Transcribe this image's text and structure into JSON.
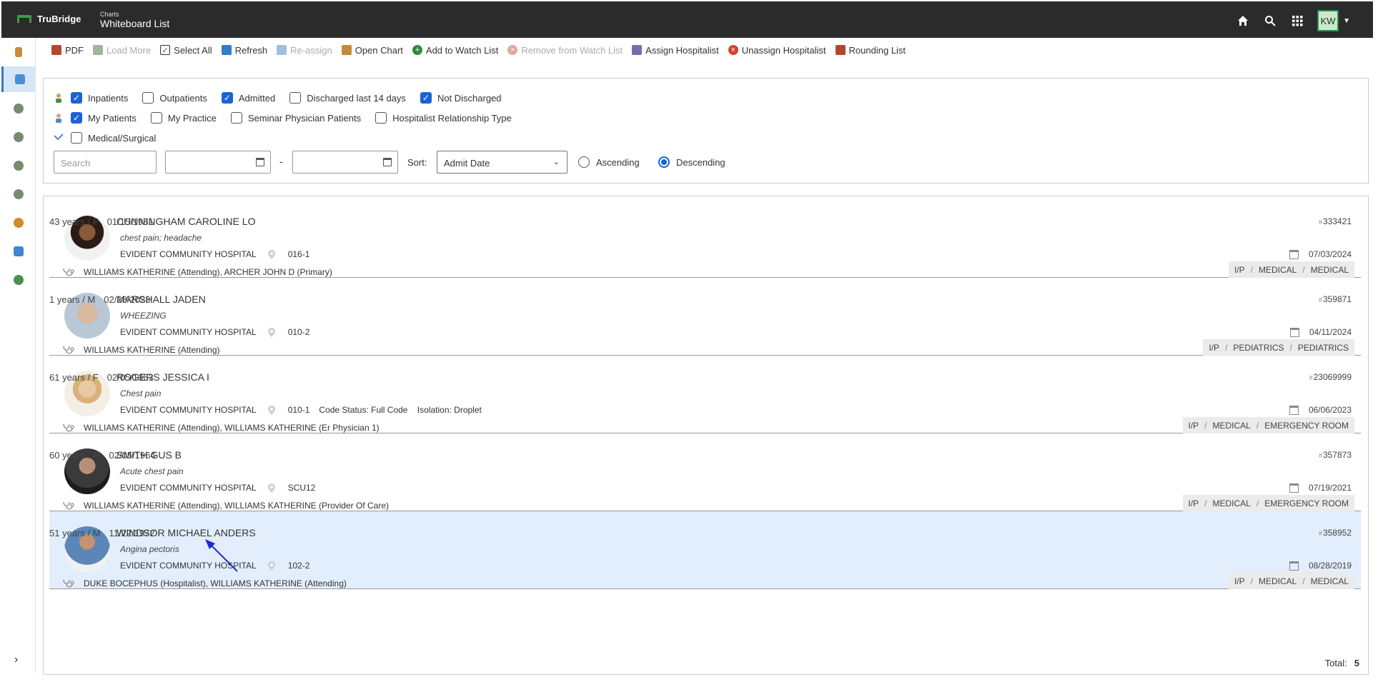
{
  "header": {
    "brand": "TruBridge",
    "breadcrumb_small": "Charts",
    "title": "Whiteboard List",
    "icons": [
      "home-icon",
      "search-icon",
      "apps-grid-icon"
    ],
    "user_initials": "KW",
    "colors": {
      "bar": "#2b2b2b",
      "accent": "#3a9b4a"
    }
  },
  "toolbar": {
    "items": [
      {
        "label": "PDF",
        "icon": "pdf-icon",
        "enabled": true
      },
      {
        "label": "Load More",
        "icon": "load-more-icon",
        "enabled": false
      },
      {
        "label": "Select All",
        "icon": "select-all-checkbox-icon",
        "enabled": true
      },
      {
        "label": "Refresh",
        "icon": "refresh-icon",
        "enabled": true
      },
      {
        "label": "Re-assign",
        "icon": "reassign-icon",
        "enabled": false
      },
      {
        "label": "Open Chart",
        "icon": "chart-icon",
        "enabled": true
      },
      {
        "label": "Add to Watch List",
        "icon": "plus-circle-icon",
        "enabled": true
      },
      {
        "label": "Remove from Watch List",
        "icon": "remove-circle-icon",
        "enabled": false
      },
      {
        "label": "Assign Hospitalist",
        "icon": "assign-icon",
        "enabled": true
      },
      {
        "label": "Unassign Hospitalist",
        "icon": "unassign-icon",
        "enabled": true
      },
      {
        "label": "Rounding List",
        "icon": "rounding-list-icon",
        "enabled": true
      }
    ]
  },
  "filters": {
    "row1": [
      {
        "label": "Inpatients",
        "checked": true
      },
      {
        "label": "Outpatients",
        "checked": false
      },
      {
        "label": "Admitted",
        "checked": true
      },
      {
        "label": "Discharged last 14 days",
        "checked": false
      },
      {
        "label": "Not Discharged",
        "checked": true
      }
    ],
    "row2": [
      {
        "label": "My Patients",
        "checked": true
      },
      {
        "label": "My Practice",
        "checked": false
      },
      {
        "label": "Seminar Physician Patients",
        "checked": false
      },
      {
        "label": "Hospitalist Relationship Type",
        "checked": false
      }
    ],
    "row3": [
      {
        "label": "Medical/Surgical",
        "checked": false
      }
    ],
    "search_placeholder": "Search",
    "date_from": "",
    "date_to": "",
    "date_separator": "-",
    "sort_label": "Sort:",
    "sort_value": "Admit Date",
    "ascending_label": "Ascending",
    "descending_label": "Descending",
    "sort_direction": "Descending"
  },
  "patients": [
    {
      "name": "CUNNINGHAM CAROLINE LO",
      "age_sex": "43 years / F",
      "dob": "01/15/1981",
      "complaint": "chest pain; headache",
      "facility": "EVIDENT COMMUNITY HOSPITAL",
      "room": "016-1",
      "extra": "",
      "providers": "WILLIAMS KATHERINE (Attending), ARCHER JOHN D (Primary)",
      "id": "333421",
      "date": "07/03/2024",
      "tags": [
        "I/P",
        "MEDICAL",
        "MEDICAL"
      ],
      "selected": false
    },
    {
      "name": "MARSHALL JADEN",
      "age_sex": "1 years / M",
      "dob": "02/28/2023",
      "complaint": "WHEEZING",
      "facility": "EVIDENT COMMUNITY HOSPITAL",
      "room": "010-2",
      "extra": "",
      "providers": "WILLIAMS KATHERINE (Attending)",
      "id": "359871",
      "date": "04/11/2024",
      "tags": [
        "I/P",
        "PEDIATRICS",
        "PEDIATRICS"
      ],
      "selected": false
    },
    {
      "name": "ROGERS JESSICA I",
      "age_sex": "61 years / F",
      "dob": "02/05/1963",
      "complaint": "Chest pain",
      "facility": "EVIDENT COMMUNITY HOSPITAL",
      "room": "010-1",
      "extra": "Code Status: Full Code    Isolation: Droplet",
      "providers": "WILLIAMS KATHERINE (Attending), WILLIAMS KATHERINE (Er Physician 1)",
      "id": "23069999",
      "date": "06/06/2023",
      "tags": [
        "I/P",
        "MEDICAL",
        "EMERGENCY ROOM"
      ],
      "selected": false
    },
    {
      "name": "SMITH GUS B",
      "age_sex": "60 years / M",
      "dob": "02/05/1964",
      "complaint": "Acute chest pain",
      "facility": "EVIDENT COMMUNITY HOSPITAL",
      "room": "SCU12",
      "extra": "",
      "providers": "WILLIAMS KATHERINE (Attending), WILLIAMS KATHERINE (Provider Of Care)",
      "id": "357873",
      "date": "07/19/2021",
      "tags": [
        "I/P",
        "MEDICAL",
        "EMERGENCY ROOM"
      ],
      "selected": false
    },
    {
      "name": "WINDSOR MICHAEL ANDERS",
      "age_sex": "51 years / M",
      "dob": "11/22/1972",
      "complaint": "Angina pectoris",
      "facility": "EVIDENT COMMUNITY HOSPITAL",
      "room": "102-2",
      "extra": "",
      "providers": "DUKE BOCEPHUS (Hospitalist), WILLIAMS KATHERINE (Attending)",
      "id": "358952",
      "date": "08/28/2019",
      "tags": [
        "I/P",
        "MEDICAL",
        "MEDICAL"
      ],
      "selected": true
    }
  ],
  "footer": {
    "total_label": "Total:",
    "total_value": "5"
  }
}
